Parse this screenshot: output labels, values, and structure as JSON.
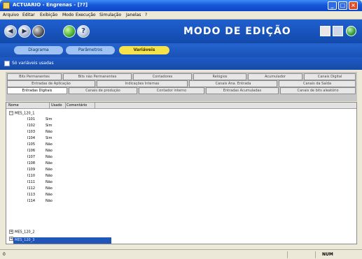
{
  "window": {
    "title": "ACTUARIO - Engrenas - [??]",
    "controls": {
      "minimize": "_",
      "maximize": "□",
      "close": "×"
    }
  },
  "menu": {
    "items": [
      "Arquivo",
      "Editar",
      "Exibição",
      "Modo",
      "Execução",
      "Simulação",
      "Janelas",
      "?"
    ]
  },
  "toolbar": {
    "mode_title": "MODO DE EDIÇÃO",
    "tools": [
      {
        "icon": "back-icon",
        "glyph": "◀"
      },
      {
        "icon": "forward-icon",
        "glyph": "▶"
      },
      {
        "icon": "record-icon",
        "glyph": "●"
      },
      {
        "icon": "run-icon",
        "glyph": "▶"
      },
      {
        "icon": "help-icon",
        "glyph": "?"
      }
    ],
    "right_tools": [
      "grid-icon",
      "document-icon",
      "globe-icon"
    ]
  },
  "modes": {
    "tabs": [
      {
        "label": "Diagrama",
        "active": false
      },
      {
        "label": "Parâmetros",
        "active": false
      },
      {
        "label": "Variáveis",
        "active": true
      }
    ]
  },
  "filter": {
    "label": "Só variáveis usadas",
    "checked": false
  },
  "category_tabs": {
    "row1": [
      "Bits Permanentes",
      "Bits não Permanentes",
      "Contadores",
      "Relógios",
      "Acumulador",
      "Canais Digital"
    ],
    "row2": [
      "Entradas de Aplicação",
      "Indicações Internas",
      "Canais Ana. Entrada",
      "Canais da Saída"
    ],
    "row3": [
      "Entradas Digitais",
      "Canais de produção",
      "Contador interno",
      "Entradas Acumuladas",
      "Canais de bits aleatório"
    ]
  },
  "table": {
    "headers": {
      "name": "Nome",
      "used": "Usado",
      "comment": "Comentário"
    },
    "groups": [
      {
        "name": "MES_120_1",
        "expanded": true,
        "children": [
          {
            "name": "I101",
            "used": "Sim"
          },
          {
            "name": "I102",
            "used": "Sim"
          },
          {
            "name": "I103",
            "used": "Não"
          },
          {
            "name": "I104",
            "used": "Sim"
          },
          {
            "name": "I105",
            "used": "Não"
          },
          {
            "name": "I106",
            "used": "Não"
          },
          {
            "name": "I107",
            "used": "Não"
          },
          {
            "name": "I108",
            "used": "Não"
          },
          {
            "name": "I109",
            "used": "Não"
          },
          {
            "name": "I110",
            "used": "Não"
          },
          {
            "name": "I111",
            "used": "Não"
          },
          {
            "name": "I112",
            "used": "Não"
          },
          {
            "name": "I113",
            "used": "Não"
          },
          {
            "name": "I114",
            "used": "Não"
          }
        ]
      },
      {
        "name": "MES_120_2",
        "expanded": false
      },
      {
        "name": "MES_120_3",
        "expanded": false,
        "selected": true
      }
    ]
  },
  "status": {
    "left": "0",
    "right": "NUM"
  },
  "colors": {
    "title_blue": "#1758d8",
    "toolbar_blue": "#1f5fcf",
    "active_mode": "#f6e24a",
    "selection": "#1f56b8"
  }
}
